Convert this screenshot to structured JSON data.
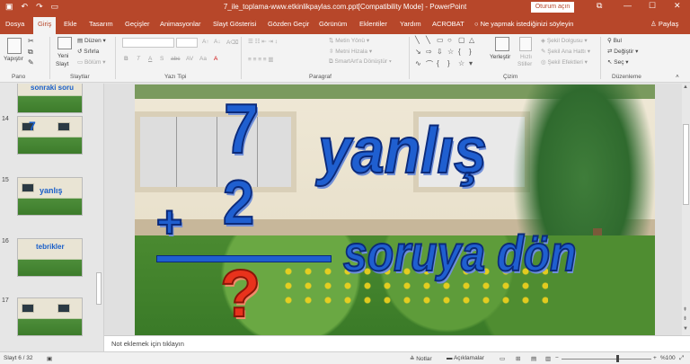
{
  "titlebar": {
    "title": "7_ile_toplama-www.etkinlikpaylas.com.ppt[Compatibility Mode]  -  PowerPoint",
    "signin": "Oturum açın",
    "quick_access": {
      "save_icon": "save-icon",
      "undo_icon": "undo-icon",
      "redo_icon": "redo-icon",
      "start_icon": "start-from-beginning-icon"
    },
    "window_controls": {
      "restore": "⧉",
      "minimize": "—",
      "maximize": "☐",
      "close": "✕"
    }
  },
  "tabs": [
    {
      "label": "Dosya"
    },
    {
      "label": "Giriş"
    },
    {
      "label": "Ekle"
    },
    {
      "label": "Tasarım"
    },
    {
      "label": "Geçişler"
    },
    {
      "label": "Animasyonlar"
    },
    {
      "label": "Slayt Gösterisi"
    },
    {
      "label": "Gözden Geçir"
    },
    {
      "label": "Görünüm"
    },
    {
      "label": "Eklentiler"
    },
    {
      "label": "Yardım"
    },
    {
      "label": "ACROBAT"
    }
  ],
  "active_tab": "Giriş",
  "tell_me": "Ne yapmak istediğinizi söyleyin",
  "share": "Paylaş",
  "ribbon": {
    "pano": {
      "group_label": "Pano",
      "paste": "Yapıştır"
    },
    "slaytlar": {
      "group_label": "Slaytlar",
      "new_slide": "Yeni",
      "new_slide_2": "Slayt",
      "layout": "Düzen",
      "reset": "Sıfırla",
      "section": "Bölüm"
    },
    "yazi_tipi": {
      "group_label": "Yazı Tipi",
      "buttons": [
        "B",
        "T",
        "A",
        "S",
        "abc",
        "AV",
        "Aa",
        "A"
      ]
    },
    "paragraf": {
      "group_label": "Paragraf",
      "text_direction": "Metin Yönü",
      "align_text": "Metni Hizala",
      "smartart": "SmartArt'a Dönüştür"
    },
    "cizim": {
      "group_label": "Çizim",
      "arrange": "Yerleştir",
      "quick_styles": "Hızlı",
      "quick_styles_2": "Stiller",
      "shape_fill": "Şekil Dolgusu",
      "shape_outline": "Şekil Ana Hattı",
      "shape_effects": "Şekil Efektleri"
    },
    "duzenleme": {
      "group_label": "Düzenleme",
      "find": "Bul",
      "replace": "Değiştir",
      "select": "Seç"
    }
  },
  "thumbnails": [
    {
      "number": "",
      "text": "sonraki soru"
    },
    {
      "number": "14",
      "text": ""
    },
    {
      "number": "15",
      "text": "yanlış"
    },
    {
      "number": "16",
      "text": "tebrikler"
    },
    {
      "number": "17",
      "text": ""
    }
  ],
  "slide": {
    "seven": "7",
    "two": "2",
    "plus": "+",
    "wrong": "yanlış",
    "go_back": "soruya dön",
    "question_mark": "?"
  },
  "notes_placeholder": "Not eklemek için tıklayın",
  "status": {
    "slide_counter": "Slayt 6 / 32",
    "notes": "Notlar",
    "comments": "Açıklamalar",
    "zoom": "%100"
  },
  "colors": {
    "accent": "#b7472a",
    "slide_text_blue": "#1f5fd0",
    "slide_question_red": "#e8321c"
  }
}
